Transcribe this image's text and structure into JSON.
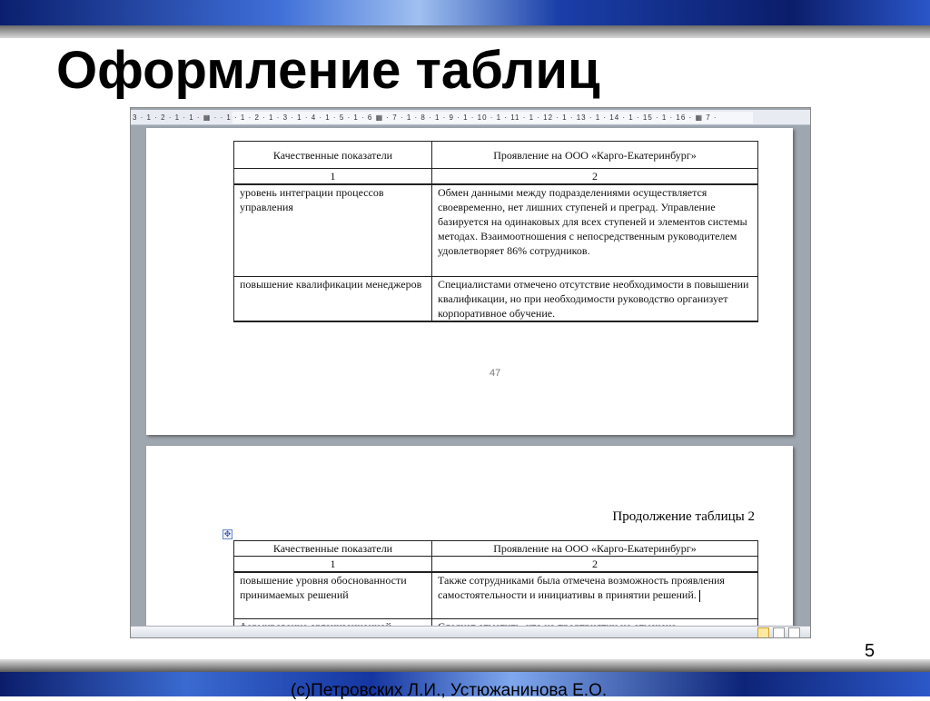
{
  "slide": {
    "title": "Оформление таблиц",
    "number": "5",
    "footer": "(c)Петровских Л.И., Устюжанинова Е.О."
  },
  "ruler": {
    "text": "3 · 1 · 2 · 1 · 1 · ▦ · · 1 · 1 · 2 · 1 · 3 · 1 · 4 · 1 · 5 · 1 · 6 ▦ · 7 · 1 · 8 · 1 · 9 · 1 · 10 · 1 · 11 · 1 · 12 · 1 · 13 · 1 · 14 · 1 · 15 · 1 · 16 · ▦ 7 ·"
  },
  "page1": {
    "headers": [
      "Качественные показатели",
      "Проявление на ООО «Карго-Екатеринбург»"
    ],
    "numbers": [
      "1",
      "2"
    ],
    "rows": [
      [
        "уровень интеграции процессов управления",
        "Обмен данными между подразделениями осуществляется своевременно, нет лишних ступеней и преград. Управление базируется на одинаковых для всех ступеней и элементов системы методах. Взаимоотношения с непосредственным руководителем удовлетворяет 86% сотрудников."
      ],
      [
        "повышение квалификации менеджеров",
        "Специалистами отмечено отсутствие необходимости в повышении квалификации, но при необходимости руководство организует корпоративное обучение."
      ]
    ],
    "page_number": "47"
  },
  "page2": {
    "caption": "Продолжение таблицы 2",
    "headers": [
      "Качественные показатели",
      "Проявление на ООО «Карго-Екатеринбург»"
    ],
    "numbers": [
      "1",
      "2"
    ],
    "rows": [
      [
        "повышение уровня обоснованности принимаемых решений",
        "Также сотрудниками была отмечена возможность проявления самостоятельности  и инициативы в принятии решений."
      ],
      [
        "формирование организационной",
        "Следует отметить, что на предприятии не отмечена"
      ]
    ]
  }
}
